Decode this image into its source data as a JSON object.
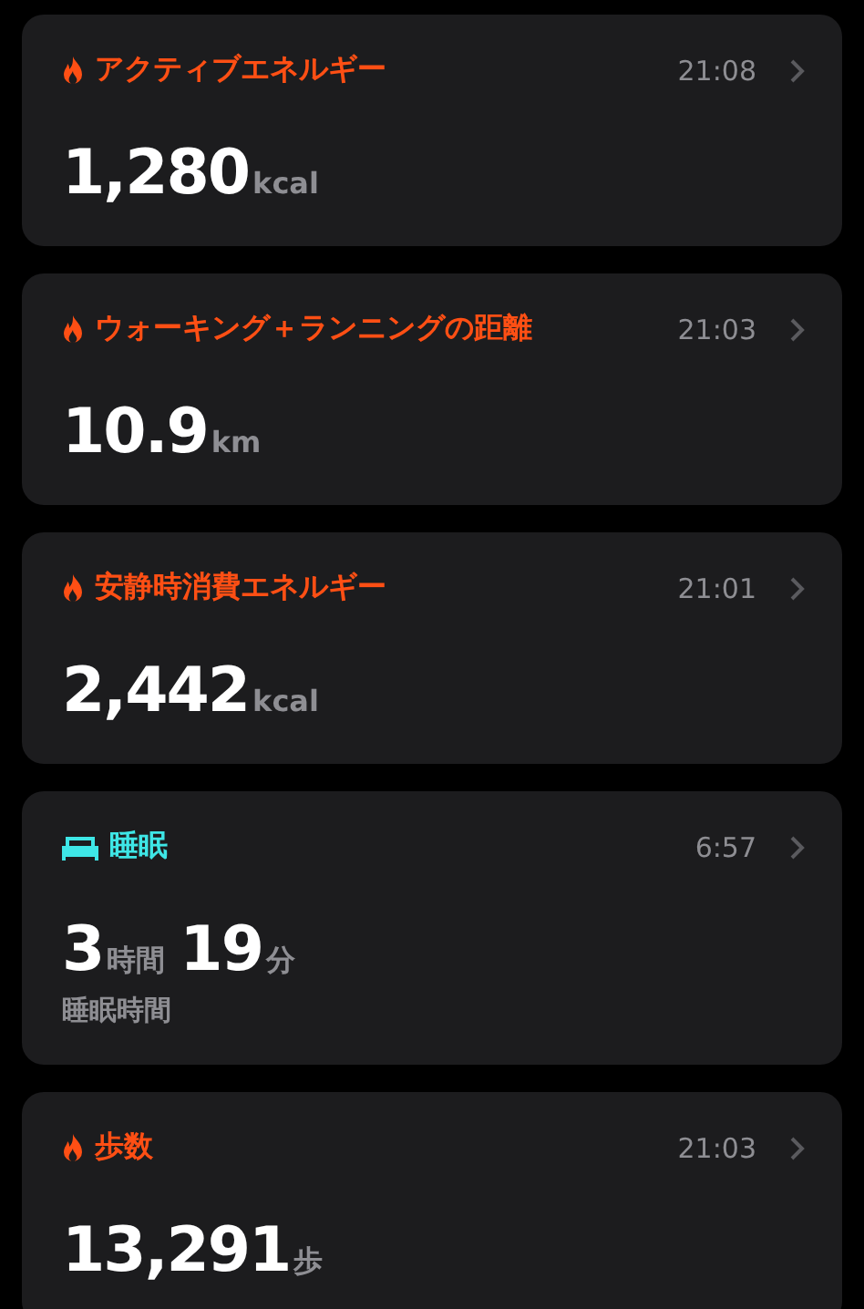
{
  "cards": [
    {
      "kind": "flame",
      "color": "#ff4f14",
      "title": "アクティブエネルギー",
      "time": "21:08",
      "value": [
        {
          "number": "1,280",
          "unit": "kcal"
        }
      ]
    },
    {
      "kind": "flame",
      "color": "#ff4f14",
      "title": "ウォーキング＋ランニングの距離",
      "time": "21:03",
      "value": [
        {
          "number": "10.9",
          "unit": "km"
        }
      ]
    },
    {
      "kind": "flame",
      "color": "#ff4f14",
      "title": "安静時消費エネルギー",
      "time": "21:01",
      "value": [
        {
          "number": "2,442",
          "unit": "kcal"
        }
      ]
    },
    {
      "kind": "bed",
      "color": "#3ee6e6",
      "title": "睡眠",
      "time": "6:57",
      "value": [
        {
          "number": "3",
          "unit": "時間"
        },
        {
          "number": "19",
          "unit": "分"
        }
      ],
      "caption": "睡眠時間"
    },
    {
      "kind": "flame",
      "color": "#ff4f14",
      "title": "歩数",
      "time": "21:03",
      "value": [
        {
          "number": "13,291",
          "unit": "歩"
        }
      ]
    }
  ]
}
